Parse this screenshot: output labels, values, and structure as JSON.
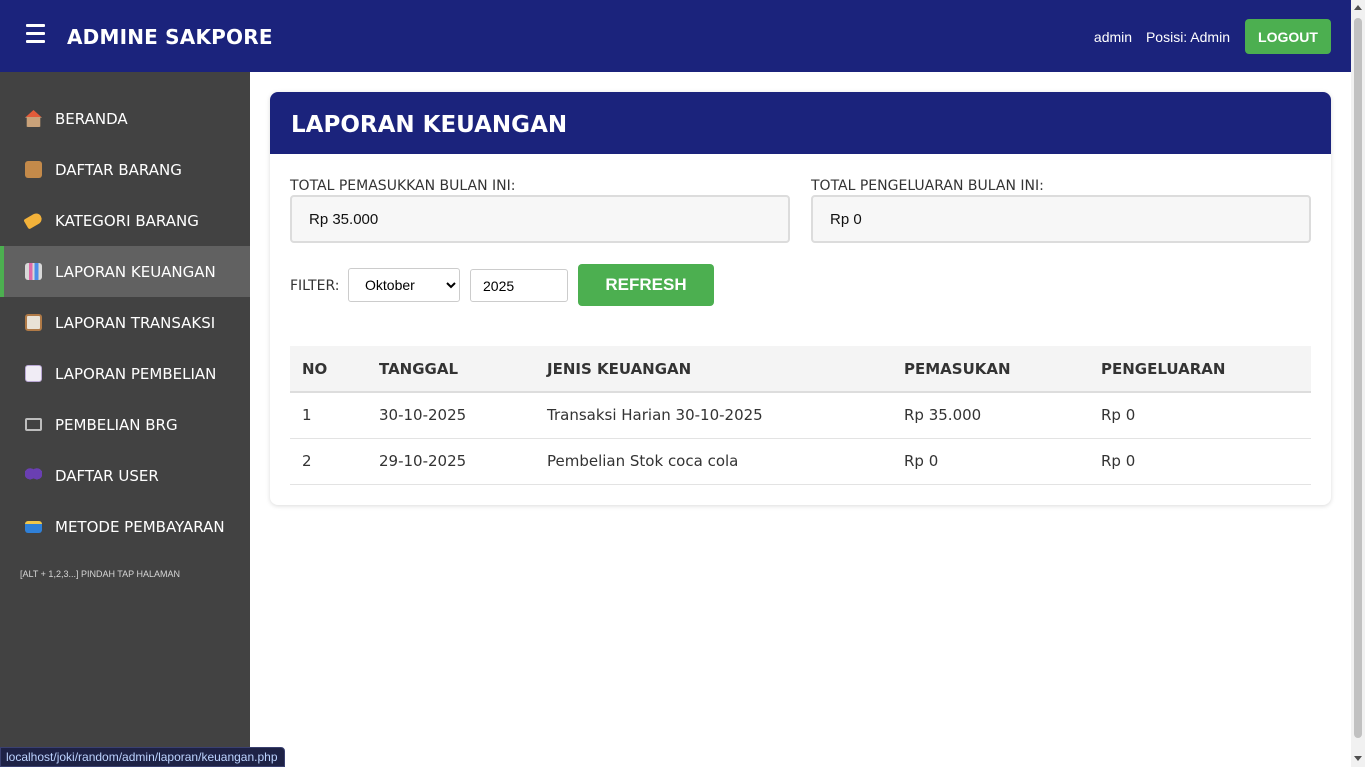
{
  "header": {
    "brand": "ADMINE SAKPORE",
    "username": "admin",
    "position": "Posisi: Admin",
    "logout_label": "LOGOUT"
  },
  "sidebar": {
    "items": [
      {
        "label": "BERANDA",
        "icon": "house-icon"
      },
      {
        "label": "DAFTAR BARANG",
        "icon": "box-icon"
      },
      {
        "label": "KATEGORI BARANG",
        "icon": "tag-icon"
      },
      {
        "label": "LAPORAN KEUANGAN",
        "icon": "bar-chart-icon",
        "active": true
      },
      {
        "label": "LAPORAN TRANSAKSI",
        "icon": "clipboard-icon"
      },
      {
        "label": "LAPORAN PEMBELIAN",
        "icon": "document-icon"
      },
      {
        "label": "PEMBELIAN BRG",
        "icon": "cart-icon"
      },
      {
        "label": "DAFTAR USER",
        "icon": "users-icon"
      },
      {
        "label": "METODE PEMBAYARAN",
        "icon": "credit-card-icon"
      }
    ],
    "hint": "[ALT + 1,2,3...] PINDAH TAP HALAMAN"
  },
  "main": {
    "title": "LAPORAN KEUANGAN",
    "income_label": "TOTAL PEMASUKKAN BULAN INI:",
    "income_value": "Rp 35.000",
    "expense_label": "TOTAL PENGELUARAN BULAN INI:",
    "expense_value": "Rp 0",
    "filter_label": "FILTER:",
    "month_selected": "Oktober",
    "year_value": "2025",
    "refresh_label": "REFRESH"
  },
  "table": {
    "headers": [
      "NO",
      "TANGGAL",
      "JENIS KEUANGAN",
      "PEMASUKAN",
      "PENGELUARAN"
    ],
    "rows": [
      [
        "1",
        "30-10-2025",
        "Transaksi Harian 30-10-2025",
        "Rp 35.000",
        "Rp 0"
      ],
      [
        "2",
        "29-10-2025",
        "Pembelian Stok coca cola",
        "Rp 0",
        "Rp 0"
      ]
    ]
  },
  "status_bar": {
    "url": "localhost/joki/random/admin/laporan/keuangan.php"
  },
  "colors": {
    "primary": "#1b237c",
    "accent": "#4caf50",
    "sidebar": "#424242"
  }
}
